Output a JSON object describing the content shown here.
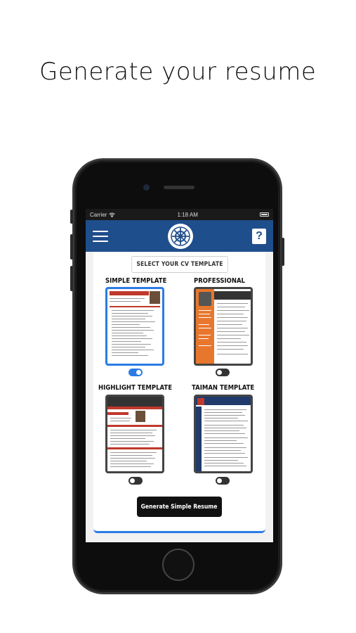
{
  "headline": "Generate your resume",
  "status_bar": {
    "carrier": "Carrier",
    "time": "1:18 AM"
  },
  "nav": {
    "menu_icon": "hamburger-menu-icon",
    "logo": "ship-wheel-logo",
    "help_icon": "help-question-icon"
  },
  "select_title": "SELECT YOUR CV TEMPLATE",
  "templates": [
    {
      "label": "SIMPLE TEMPLATE",
      "selected": true
    },
    {
      "label": "PROFESSIONAL",
      "selected": false
    },
    {
      "label": "HIGHLIGHT TEMPLATE",
      "selected": false
    },
    {
      "label": "TAIMAN TEMPLATE",
      "selected": false
    }
  ],
  "generate_button": "Generate Simple Resume",
  "colors": {
    "nav": "#1f4e8c",
    "accent": "#2c7be5",
    "button": "#111111",
    "professional_orange": "#e8772e",
    "highlight_red": "#c0392b"
  }
}
